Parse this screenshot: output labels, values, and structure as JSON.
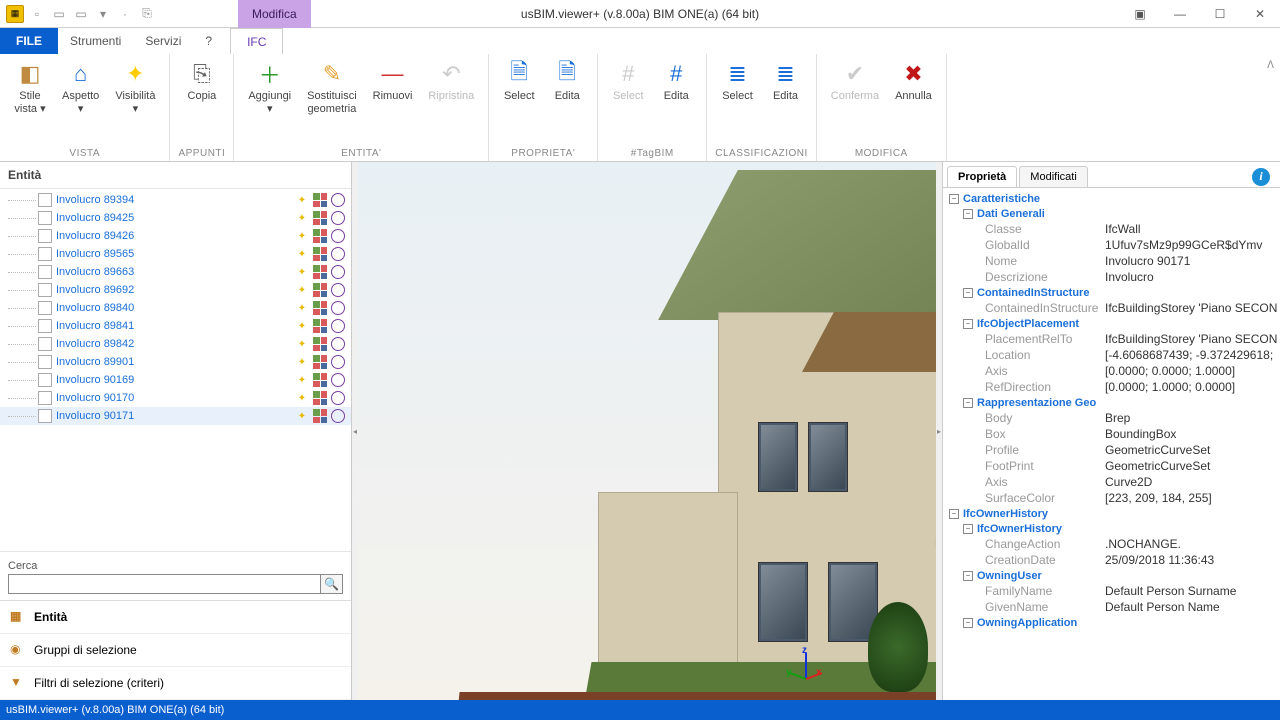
{
  "window": {
    "context_tab": "Modifica",
    "title": "usBIM.viewer+ (v.8.00a)  BIM ONE(a) (64 bit)"
  },
  "menu": {
    "file": "FILE",
    "items": [
      "Strumenti",
      "Servizi",
      "?"
    ],
    "active": "IFC"
  },
  "ribbon": {
    "groups": [
      {
        "title": "VISTA",
        "buttons": [
          {
            "k": "stile-vista",
            "l": "Stile\nvista ▾",
            "ico": "cube",
            "c": "#c08a40"
          },
          {
            "k": "aspetto",
            "l": "Aspetto\n▾",
            "ico": "house",
            "c": "#1a6fd8"
          },
          {
            "k": "visibilita",
            "l": "Visibilità\n▾",
            "ico": "bulb",
            "c": "#ffcc00"
          }
        ]
      },
      {
        "title": "APPUNTI",
        "buttons": [
          {
            "k": "copia",
            "l": "Copia",
            "ico": "copy",
            "c": "#666"
          }
        ]
      },
      {
        "title": "ENTITA'",
        "buttons": [
          {
            "k": "aggiungi",
            "l": "Aggiungi\n▾",
            "ico": "plus",
            "c": "#2a9a2a"
          },
          {
            "k": "sostituisci",
            "l": "Sostituisci\ngeometria",
            "ico": "pencil",
            "c": "#e6a030"
          },
          {
            "k": "rimuovi",
            "l": "Rimuovi",
            "ico": "minus",
            "c": "#d03030"
          },
          {
            "k": "ripristina",
            "l": "Ripristina",
            "ico": "undo",
            "c": "#ccc",
            "dis": true
          }
        ]
      },
      {
        "title": "PROPRIETA'",
        "buttons": [
          {
            "k": "p-select",
            "l": "Select",
            "ico": "doc-arrow",
            "c": "#1a6fd8"
          },
          {
            "k": "p-edita",
            "l": "Edita",
            "ico": "doc-gear",
            "c": "#1a6fd8"
          }
        ]
      },
      {
        "title": "#TagBIM",
        "buttons": [
          {
            "k": "t-select",
            "l": "Select",
            "ico": "hash",
            "c": "#ccc",
            "dis": true
          },
          {
            "k": "t-edita",
            "l": "Edita",
            "ico": "hash-pen",
            "c": "#1a6fd8"
          }
        ]
      },
      {
        "title": "CLASSIFICAZIONI",
        "buttons": [
          {
            "k": "c-select",
            "l": "Select",
            "ico": "list-arrow",
            "c": "#1a6fd8"
          },
          {
            "k": "c-edita",
            "l": "Edita",
            "ico": "list-pen",
            "c": "#1a6fd8"
          }
        ]
      },
      {
        "title": "MODIFICA",
        "buttons": [
          {
            "k": "conferma",
            "l": "Conferma",
            "ico": "check",
            "c": "#ccc",
            "dis": true
          },
          {
            "k": "annulla",
            "l": "Annulla",
            "ico": "x",
            "c": "#c01818"
          }
        ]
      }
    ]
  },
  "left": {
    "title": "Entità",
    "search_label": "Cerca",
    "search_ph": "",
    "tree": [
      {
        "l": "Involucro 89394"
      },
      {
        "l": "Involucro 89425"
      },
      {
        "l": "Involucro 89426"
      },
      {
        "l": "Involucro 89565"
      },
      {
        "l": "Involucro 89663"
      },
      {
        "l": "Involucro 89692"
      },
      {
        "l": "Involucro 89840"
      },
      {
        "l": "Involucro 89841"
      },
      {
        "l": "Involucro 89842"
      },
      {
        "l": "Involucro 89901"
      },
      {
        "l": "Involucro 90169"
      },
      {
        "l": "Involucro 90170"
      },
      {
        "l": "Involucro 90171",
        "sel": true
      }
    ],
    "tabs": [
      {
        "k": "entita",
        "l": "Entità",
        "ico": "box"
      },
      {
        "k": "gruppi",
        "l": "Gruppi di selezione",
        "ico": "target"
      },
      {
        "k": "filtri",
        "l": "Filtri di selezione (criteri)",
        "ico": "funnel"
      }
    ]
  },
  "right": {
    "tabs": [
      {
        "l": "Proprietà",
        "active": true
      },
      {
        "l": "Modificati"
      }
    ],
    "groups": [
      {
        "t": "Caratteristiche",
        "lvl": 0,
        "rows": []
      },
      {
        "t": "Dati Generali",
        "lvl": 1,
        "rows": [
          {
            "k": "Classe",
            "v": "IfcWall"
          },
          {
            "k": "GlobalId",
            "v": "1Ufuv7sMz9p99GCeR$dYmv"
          },
          {
            "k": "Nome",
            "v": "Involucro 90171"
          },
          {
            "k": "Descrizione",
            "v": "Involucro"
          }
        ]
      },
      {
        "t": "ContainedInStructure",
        "lvl": 1,
        "rows": [
          {
            "k": "ContainedInStructure",
            "v": "IfcBuildingStorey 'Piano SECONDO"
          }
        ]
      },
      {
        "t": "IfcObjectPlacement",
        "lvl": 1,
        "rows": [
          {
            "k": "PlacementRelTo",
            "v": "IfcBuildingStorey 'Piano SECONDO"
          },
          {
            "k": "Location",
            "v": "[-4.6068687439; -9.372429618;"
          },
          {
            "k": "Axis",
            "v": "[0.0000; 0.0000; 1.0000]"
          },
          {
            "k": "RefDirection",
            "v": "[0.0000; 1.0000; 0.0000]"
          }
        ]
      },
      {
        "t": "Rappresentazione Geo",
        "lvl": 1,
        "rows": [
          {
            "k": "Body",
            "v": "Brep"
          },
          {
            "k": "Box",
            "v": "BoundingBox"
          },
          {
            "k": "Profile",
            "v": "GeometricCurveSet"
          },
          {
            "k": "FootPrint",
            "v": "GeometricCurveSet"
          },
          {
            "k": "Axis",
            "v": "Curve2D"
          },
          {
            "k": "SurfaceColor",
            "v": "[223, 209, 184, 255]"
          }
        ]
      },
      {
        "t": "IfcOwnerHistory",
        "lvl": 0,
        "rows": []
      },
      {
        "t": "IfcOwnerHistory",
        "lvl": 1,
        "rows": [
          {
            "k": "ChangeAction",
            "v": ".NOCHANGE."
          },
          {
            "k": "CreationDate",
            "v": "25/09/2018 11:36:43"
          }
        ]
      },
      {
        "t": "OwningUser",
        "lvl": 1,
        "rows": [
          {
            "k": "FamilyName",
            "v": "Default Person Surname"
          },
          {
            "k": "GivenName",
            "v": "Default Person Name"
          }
        ]
      },
      {
        "t": "OwningApplication",
        "lvl": 1,
        "rows": []
      }
    ]
  },
  "status": "usBIM.viewer+ (v.8.00a)  BIM ONE(a) (64 bit)"
}
